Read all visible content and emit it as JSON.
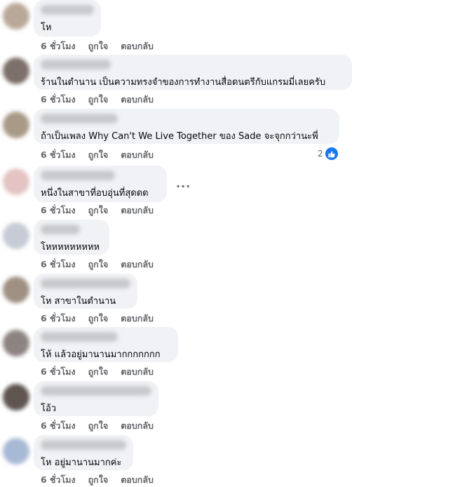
{
  "comments": [
    {
      "text": "โห",
      "time": "6 ชั่วโมง",
      "like": "ถูกใจ",
      "reply": "ตอบกลับ"
    },
    {
      "text": "ร้านในตำนาน เป็นความทรงจำของการทำงานสื่อดนตรีกับแกรมมี่เลยครับ",
      "time": "6 ชั่วโมง",
      "like": "ถูกใจ",
      "reply": "ตอบกลับ"
    },
    {
      "text": "ถ้าเป็นเพลง Why Can't We Live Together ของ Sade จะจุกกว่านะพี่",
      "time": "6 ชั่วโมง",
      "like": "ถูกใจ",
      "reply": "ตอบกลับ",
      "reaction_count": "2",
      "reaction_icon": "like-icon",
      "reaction_color": "#1877f2"
    },
    {
      "text": "หนึ่งในสาขาที่อบอุ่นที่สุดดด",
      "time": "6 ชั่วโมง",
      "like": "ถูกใจ",
      "reply": "ตอบกลับ",
      "more": "..."
    },
    {
      "text": "โหหหหหหหหห",
      "time": "6 ชั่วโมง",
      "like": "ถูกใจ",
      "reply": "ตอบกลับ"
    },
    {
      "text": "โห สาขาในตำนาน",
      "time": "6 ชั่วโมง",
      "like": "ถูกใจ",
      "reply": "ตอบกลับ"
    },
    {
      "text": "โห้ แล้วอยู่มานานมากกกกกกก",
      "time": "6 ชั่วโมง",
      "like": "ถูกใจ",
      "reply": "ตอบกลับ"
    },
    {
      "text": "โอ้ว",
      "time": "6 ชั่วโมง",
      "like": "ถูกใจ",
      "reply": "ตอบกลับ"
    },
    {
      "text": "โห อยู่มานานมากค่ะ",
      "time": "6 ชั่วโมง",
      "like": "ถูกใจ",
      "reply": "ตอบกลับ"
    }
  ],
  "colors": {
    "bubble": "#f0f2f5",
    "meta_text": "#65676b",
    "like_blue": "#1877f2"
  }
}
